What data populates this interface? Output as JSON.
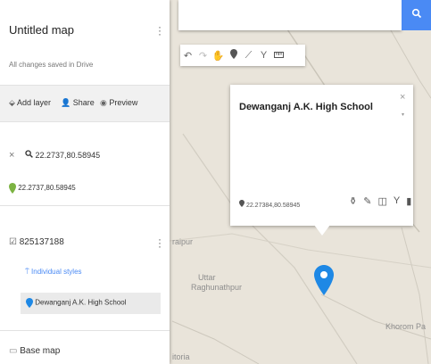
{
  "map": {
    "labels": {
      "place1": "raipur",
      "place2": "Uttar",
      "place3": "Raghunathpur",
      "place4": "Khorom Pa",
      "place5": "itoria"
    }
  },
  "search": {
    "value": ""
  },
  "sidebar": {
    "title": "Untitled map",
    "save_status": "All changes saved in Drive",
    "actions": {
      "add_layer": "Add layer",
      "share": "Share",
      "preview": "Preview"
    },
    "search_layer": {
      "query": "22.2737,80.58945",
      "result": "22.2737,80.58945"
    },
    "layer": {
      "name": "825137188",
      "style": "Individual styles",
      "item": "Dewanganj A.K. High School"
    },
    "base_map": "Base map"
  },
  "popup": {
    "title": "Dewanganj A.K. High School",
    "coords": "22.27384,80.58945"
  },
  "colors": {
    "accent": "#4a8af4",
    "marker": "#1e88e5",
    "search_pin": "#7cb342"
  }
}
